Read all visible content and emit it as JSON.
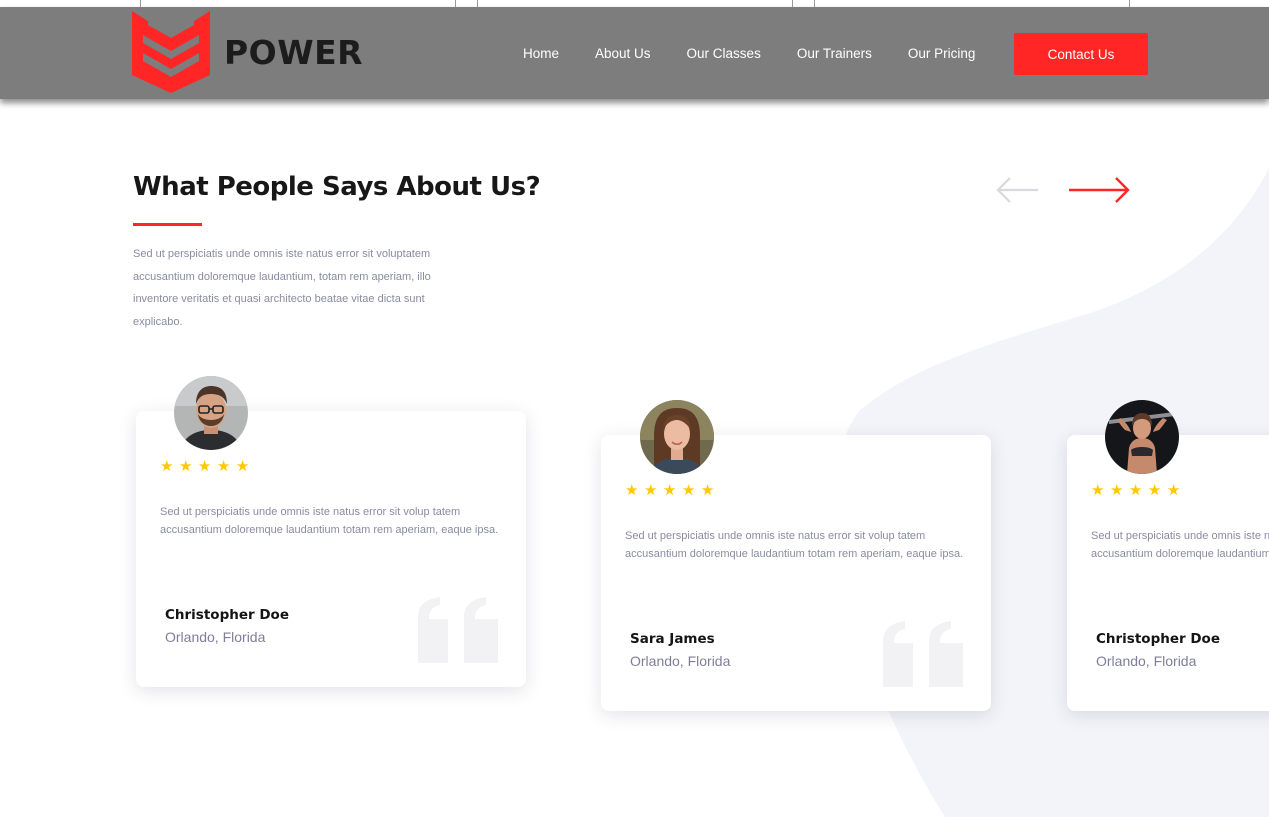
{
  "brand": {
    "name": "POWER",
    "accent": "#ff2625",
    "logo_icon": "shield-chevron-logo"
  },
  "nav": {
    "items": [
      "Home",
      "About Us",
      "Our Classes",
      "Our Trainers",
      "Our Pricing"
    ],
    "contact_label": "Contact Us"
  },
  "section": {
    "title": "What People Says About Us?",
    "intro": "Sed ut perspiciatis unde omnis iste natus error sit voluptatem accusantium doloremque laudantium, totam rem aperiam, illo inventore veritatis et quasi architecto beatae vitae dicta sunt explicabo.",
    "prev_icon": "arrow-left-icon",
    "next_icon": "arrow-right-icon"
  },
  "testimonials": [
    {
      "rating": 5,
      "text": "Sed ut perspiciatis unde omnis iste natus error sit volup tatem accusantium doloremque laudantium totam rem aperiam, eaque ipsa.",
      "name": "Christopher Doe",
      "location": "Orlando, Florida"
    },
    {
      "rating": 5,
      "text": "Sed ut perspiciatis unde omnis iste natus error sit volup tatem accusantium doloremque laudantium totam rem aperiam, eaque ipsa.",
      "name": "Sara James",
      "location": "Orlando, Florida"
    },
    {
      "rating": 5,
      "text": "Sed ut perspiciatis unde omnis iste natus error sit volup tatem accusantium doloremque laudantium totam rem aperiam, eaque ipsa.",
      "name": "Christopher Doe",
      "location": "Orlando, Florida"
    }
  ],
  "colors": {
    "header_bg": "#7d7d7d",
    "star": "#ffc800",
    "muted_text": "#8a8ba0",
    "wave": "#f3f4f9"
  }
}
